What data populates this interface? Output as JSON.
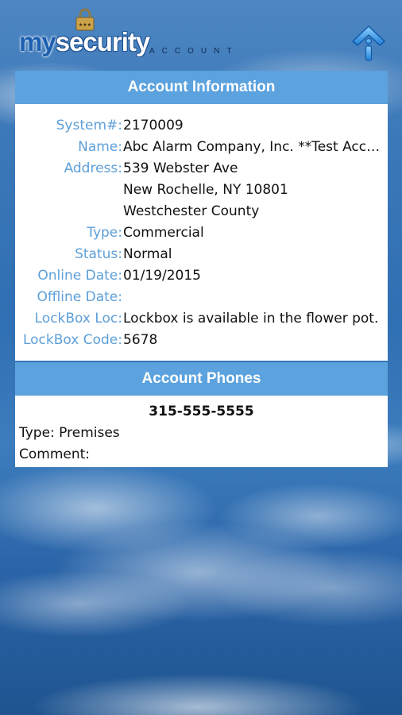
{
  "header": {
    "logo_my": "my",
    "logo_security": "security",
    "logo_account": "ACCOUNT"
  },
  "account_info": {
    "title": "Account Information",
    "fields": [
      {
        "label": "System#:",
        "value": "2170009"
      },
      {
        "label": "Name:",
        "value": "Abc Alarm Company, Inc. **Test Account"
      },
      {
        "label": "Address:",
        "value": "539 Webster Ave"
      },
      {
        "label": "",
        "value": "New Rochelle, NY 10801"
      },
      {
        "label": "",
        "value": "Westchester County"
      },
      {
        "label": "Type:",
        "value": "Commercial"
      },
      {
        "label": "Status:",
        "value": "Normal"
      },
      {
        "label": "Online Date:",
        "value": "01/19/2015"
      },
      {
        "label": "Offline Date:",
        "value": ""
      },
      {
        "label": "LockBox Loc:",
        "value": "Lockbox is available in the flower pot."
      },
      {
        "label": "LockBox Code:",
        "value": "5678"
      }
    ]
  },
  "account_phones": {
    "title": "Account Phones",
    "number": "315-555-5555",
    "type_text": "Type: Premises",
    "comment_text": "Comment:"
  },
  "colors": {
    "header_bar": "#5ba2de",
    "label_text": "#5d9fd8",
    "logo_blue": "#1d5fb0"
  },
  "icons": {
    "info_button": "up-arrow-info-icon",
    "logo_lock": "padlock-icon"
  }
}
